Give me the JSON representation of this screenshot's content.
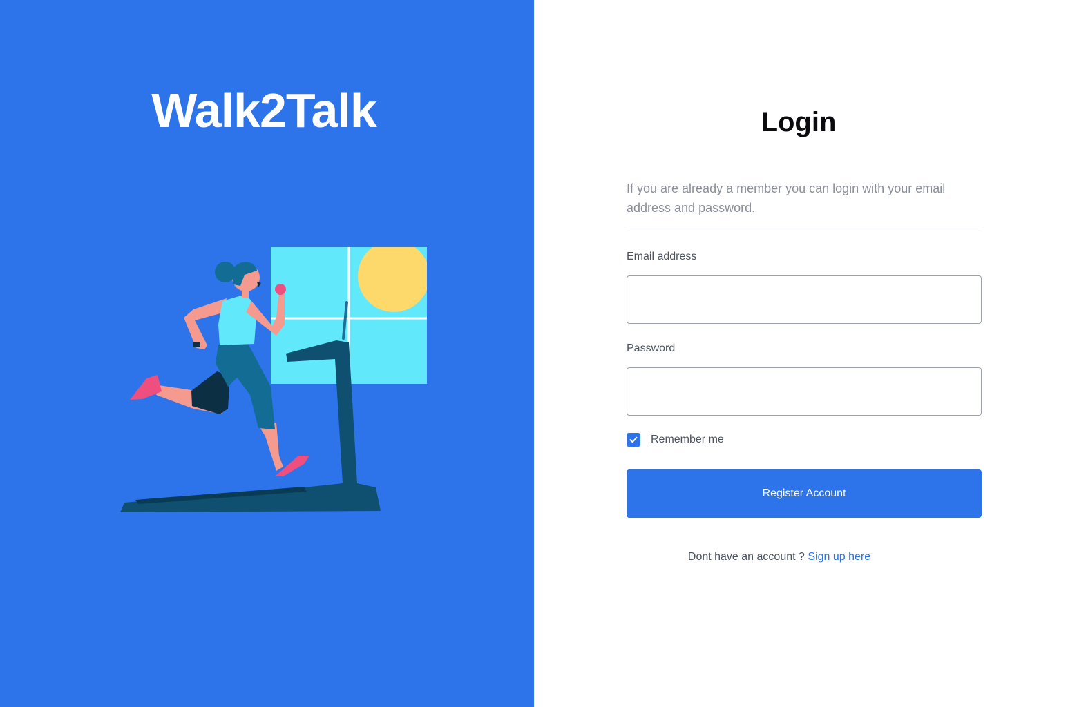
{
  "brand": {
    "name": "Walk2Talk"
  },
  "colors": {
    "brand_blue": "#2d73ea",
    "window_cyan": "#62e8fb",
    "sun_yellow": "#fdd86a",
    "treadmill_navy": "#0f4f70",
    "skin_pink": "#f59a8f",
    "shoe_pink": "#ee4f7f"
  },
  "illustration": {
    "icon": "woman-running-on-treadmill-illustration"
  },
  "login": {
    "title": "Login",
    "intro": "If you are already a member you can login with your email address and password.",
    "email_label": "Email address",
    "email_value": "",
    "email_placeholder": "",
    "password_label": "Password",
    "password_value": "",
    "password_placeholder": "",
    "remember_label": "Remember me",
    "remember_checked": true,
    "submit_label": "Register Account",
    "signup_prompt": "Dont have an account ?",
    "signup_link": "Sign up here"
  }
}
